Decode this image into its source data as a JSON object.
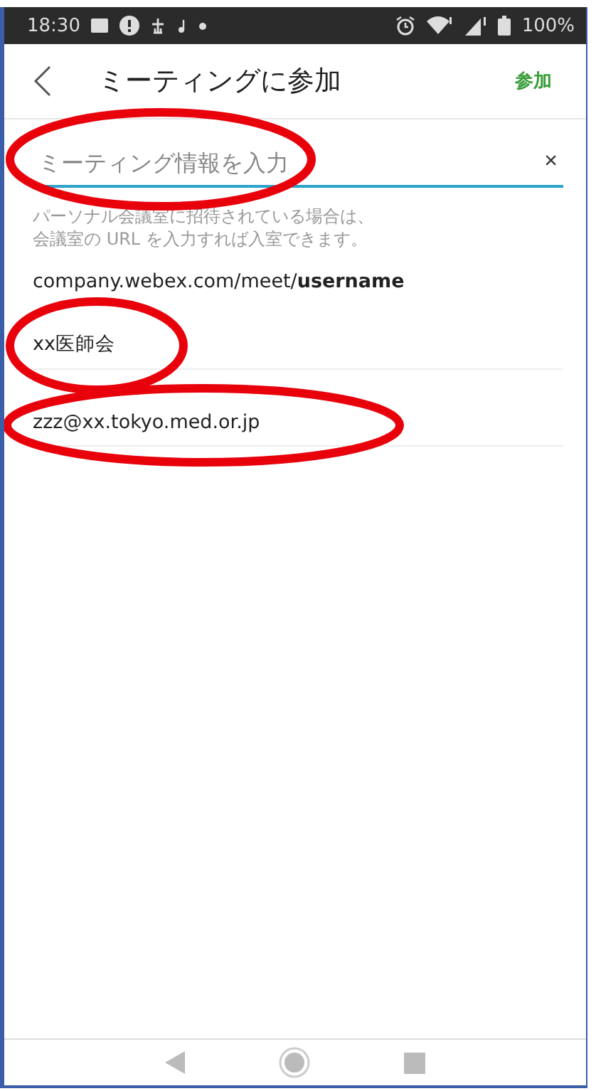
{
  "status_bar": {
    "time": "18:30",
    "battery": "100%"
  },
  "header": {
    "title": "ミーティングに参加",
    "action": "参加"
  },
  "search_field": {
    "placeholder": "ミーティング情報を入力",
    "clear": "×"
  },
  "hint": [
    "パーソナル会議室に招待されている場合は、",
    "会議室の URL を入力すれば入室できます。"
  ],
  "url_example": "company.webex.com/meet/**username**",
  "entries": [
    "xx医師会",
    "zzz@xx.tokyo.med.or.jp"
  ]
}
